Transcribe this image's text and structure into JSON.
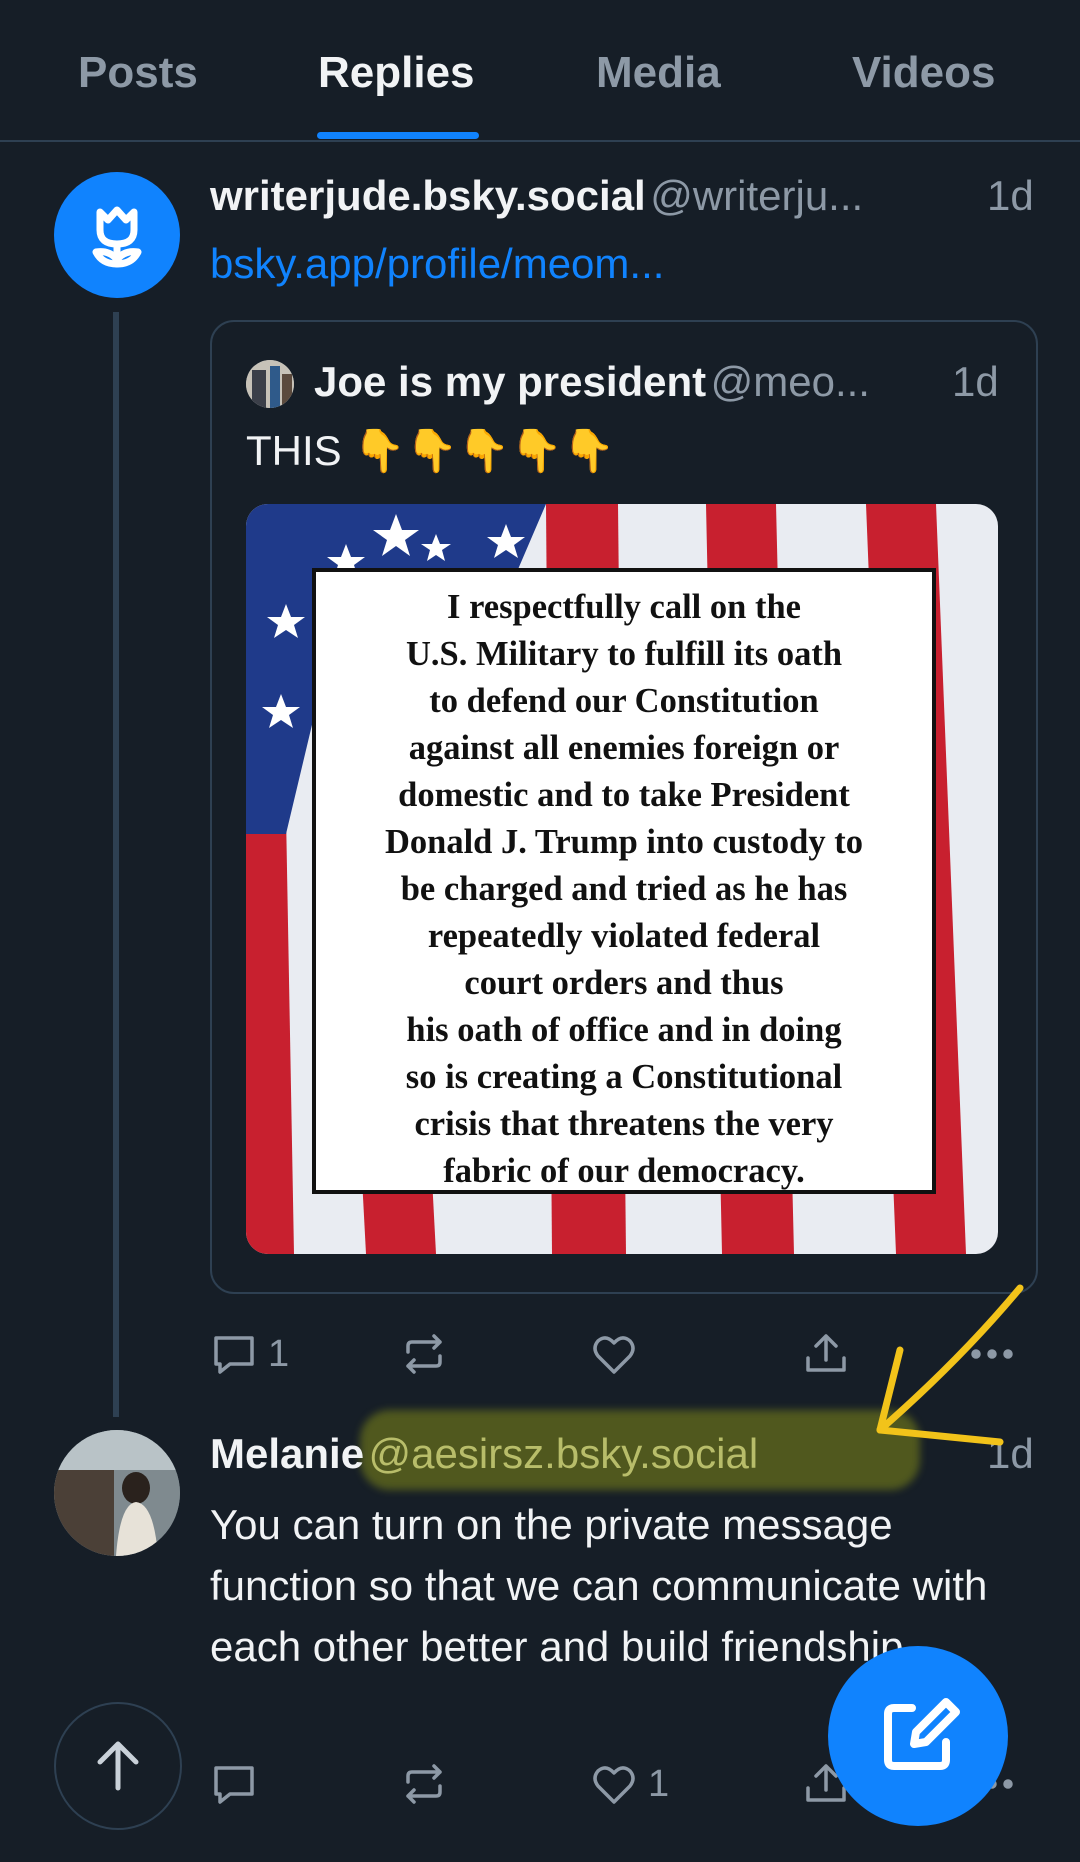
{
  "tabs": [
    {
      "label": "Posts",
      "active": false
    },
    {
      "label": "Replies",
      "active": true
    },
    {
      "label": "Media",
      "active": false
    },
    {
      "label": "Videos",
      "active": false
    }
  ],
  "post1": {
    "display_name": "writerjude.bsky.social",
    "handle": "@writerju...",
    "time": "1d",
    "link_text": "bsky.app/profile/meom...",
    "avatar_icon": "flower-icon",
    "quote": {
      "display_name": "Joe is my president",
      "handle": "@meo...",
      "time": "1d",
      "text": "THIS 👇👇👇👇👇",
      "image_text": "I respectfully call on the\nU.S. Military to fulfill its oath\nto defend our Constitution\nagainst all enemies foreign or\ndomestic and to take President\nDonald J. Trump into custody to\nbe charged and tried as he has\nrepeatedly violated federal\ncourt orders and thus\nhis oath of office and in doing\nso is creating a Constitutional\ncrisis that threatens the very\nfabric of our democracy."
    },
    "actions": {
      "reply_count": "1",
      "repost_count": "",
      "like_count": ""
    }
  },
  "post2": {
    "display_name": "Melanie",
    "handle": "@aesirsz.bsky.social",
    "time": "1d",
    "text": "You can turn on the private message function so that we can communicate with each other better and build friendship.",
    "actions": {
      "reply_count": "",
      "repost_count": "",
      "like_count": "1"
    }
  },
  "colors": {
    "background": "#161e27",
    "accent": "#1083fe",
    "muted": "#8d99a6",
    "border": "#2e4052",
    "annotation": "#f2c31a"
  },
  "icons": [
    "flower-icon",
    "reply-icon",
    "repost-icon",
    "like-icon",
    "share-icon",
    "more-icon",
    "arrow-up-icon",
    "compose-icon"
  ]
}
